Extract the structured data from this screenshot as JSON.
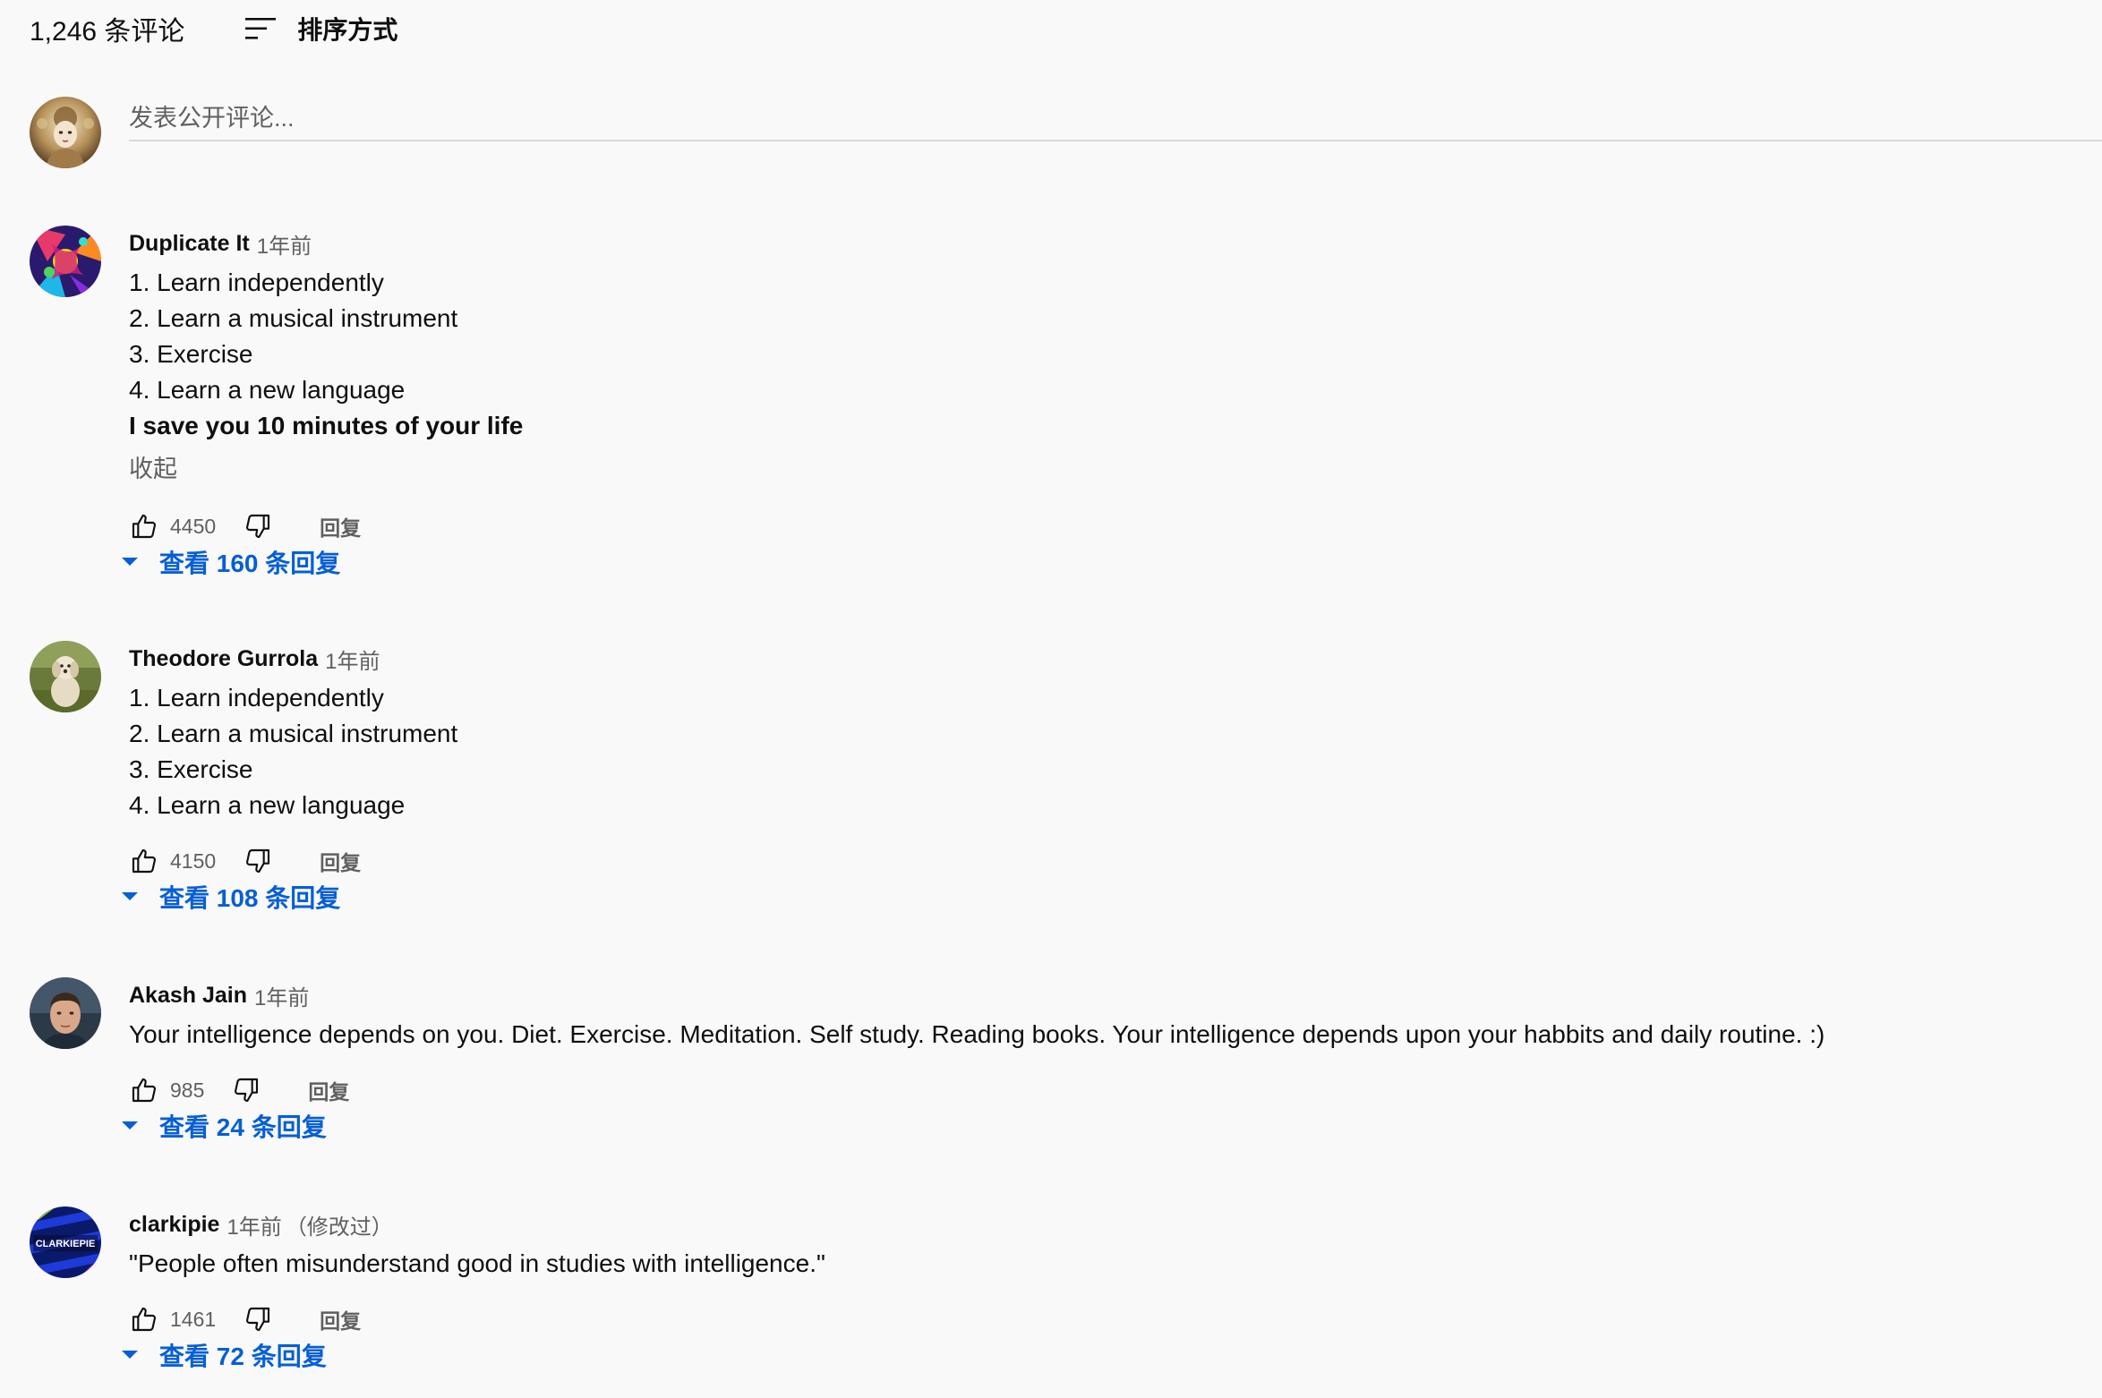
{
  "header": {
    "comment_count": "1,246 条评论",
    "sort_label": "排序方式",
    "sort_icon": "sort-icon"
  },
  "composer": {
    "placeholder": "发表公开评论..."
  },
  "icons": {
    "like": "thumb-up-icon",
    "dislike": "thumb-down-icon",
    "expand": "caret-down-icon"
  },
  "colors": {
    "background": "#f9f9f9",
    "text_primary": "#0f0f0f",
    "text_secondary": "#606060",
    "link_blue": "#065fd4",
    "divider": "#d9d9d9"
  },
  "comments": [
    {
      "author": "Duplicate It",
      "time": "1年前",
      "edited": "",
      "lines": [
        "1. Learn independently",
        "2. Learn a musical instrument",
        "3. Exercise",
        "4. Learn a new language",
        "I save you 10 minutes of your life"
      ],
      "collapse": "收起",
      "likes": "4450",
      "reply": "回复",
      "view_replies": "查看 160 条回复"
    },
    {
      "author": "Theodore Gurrola",
      "time": "1年前",
      "edited": "",
      "lines": [
        "1. Learn independently",
        "2. Learn a musical instrument",
        "3. Exercise",
        "4. Learn a new language"
      ],
      "likes": "4150",
      "reply": "回复",
      "view_replies": "查看 108 条回复"
    },
    {
      "author": "Akash Jain",
      "time": "1年前",
      "edited": "",
      "lines": [
        "Your intelligence depends on you. Diet. Exercise. Meditation. Self study. Reading books. Your intelligence depends upon your habbits and daily routine. :)"
      ],
      "likes": "985",
      "reply": "回复",
      "view_replies": "查看 24 条回复"
    },
    {
      "author": "clarkipie",
      "time": "1年前",
      "edited": "（修改过）",
      "avatar_text": "CLARKIEPIE",
      "lines": [
        "\"People often misunderstand good in studies with intelligence.\""
      ],
      "likes": "1461",
      "reply": "回复",
      "view_replies": "查看 72 条回复"
    }
  ]
}
